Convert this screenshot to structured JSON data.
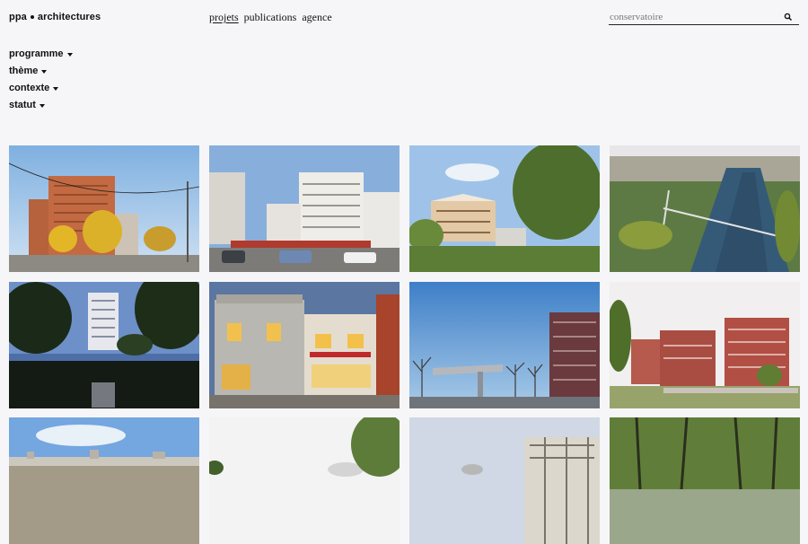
{
  "header": {
    "logo_left": "ppa",
    "logo_right": "architectures",
    "nav": [
      {
        "label": "projets",
        "active": true
      },
      {
        "label": "publications",
        "active": false
      },
      {
        "label": "agence",
        "active": false
      }
    ],
    "search": {
      "placeholder": "conservatoire",
      "icon": "search-icon"
    }
  },
  "filters": [
    {
      "label": "programme"
    },
    {
      "label": "thème"
    },
    {
      "label": "contexte"
    },
    {
      "label": "statut"
    }
  ],
  "projects": [
    {
      "image": "brick-towers-autumn-street"
    },
    {
      "image": "white-residential-blocks-parking"
    },
    {
      "image": "timber-building-trees"
    },
    {
      "image": "aerial-river-bridge"
    },
    {
      "image": "tower-reflected-in-water-night"
    },
    {
      "image": "old-facade-shopfronts-dusk"
    },
    {
      "image": "canopy-plaza-dark-facade"
    },
    {
      "image": "red-brick-blocks-embankment"
    },
    {
      "image": "city-panorama"
    },
    {
      "image": "dome-and-trees"
    },
    {
      "image": "grid-facade-tower"
    },
    {
      "image": "tree-canopy-woods"
    }
  ]
}
